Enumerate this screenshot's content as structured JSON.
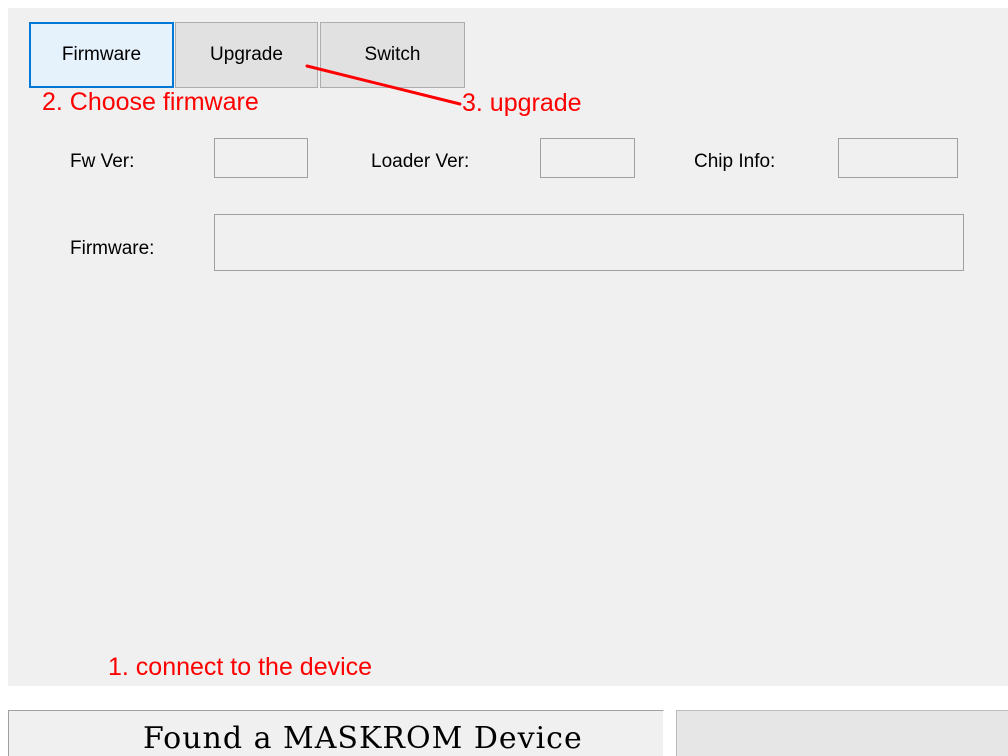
{
  "toolbar": {
    "firmware_label": "Firmware",
    "upgrade_label": "Upgrade",
    "switch_label": "Switch"
  },
  "info": {
    "fw_ver_label": "Fw Ver:",
    "fw_ver_value": "",
    "loader_ver_label": "Loader Ver:",
    "loader_ver_value": "",
    "chip_info_label": "Chip Info:",
    "chip_info_value": ""
  },
  "firmware_path": {
    "label": "Firmware:",
    "value": ""
  },
  "annotations": {
    "step1": "1. connect to the device",
    "step2": "2. Choose firmware",
    "step3": "3. upgrade",
    "color": "#ff0000"
  },
  "status": {
    "message": "Found a MASKROM Device",
    "progress": 0
  },
  "colors": {
    "panel_bg": "#f0f0f0",
    "focus_border": "#0078d7",
    "annotation": "#ff0000"
  }
}
